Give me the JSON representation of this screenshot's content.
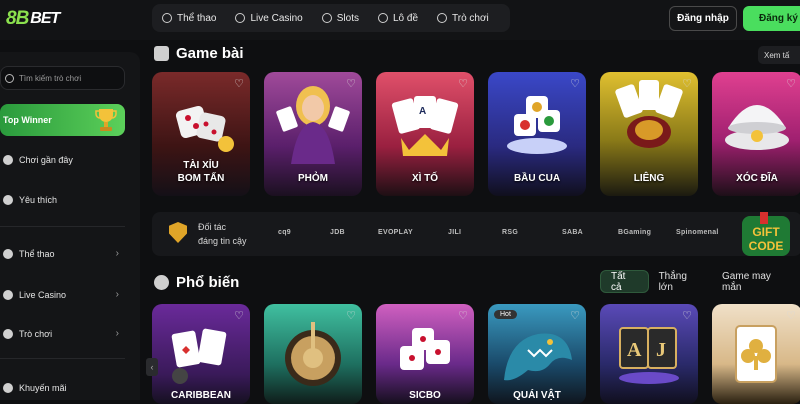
{
  "brand": {
    "logo_num": "8B",
    "logo_text": "BET"
  },
  "nav": [
    {
      "label": "Thể thao",
      "icon": "soccer-ball-icon"
    },
    {
      "label": "Live Casino",
      "icon": "chip-icon"
    },
    {
      "label": "Slots",
      "icon": "slots-icon"
    },
    {
      "label": "Lô đề",
      "icon": "lottery-icon"
    },
    {
      "label": "Trò chơi",
      "icon": "gamepad-icon"
    }
  ],
  "auth": {
    "login": "Đăng nhập",
    "register": "Đăng ký"
  },
  "sidebar": {
    "search_placeholder": "Tìm kiếm trò chơi",
    "top_winner": "Top Winner",
    "items": [
      {
        "label": "Chơi gần đây"
      },
      {
        "label": "Yêu thích"
      },
      {
        "label": "Thể thao",
        "chevron": "›"
      },
      {
        "label": "Live Casino",
        "chevron": "›"
      },
      {
        "label": "Trò chơi",
        "chevron": "›"
      },
      {
        "label": "Khuyến mãi"
      }
    ]
  },
  "section_card_games": {
    "title": "Game bài",
    "see_all": "Xem tấ",
    "cards": [
      {
        "title_1": "TÀI XỈU",
        "title_2": "BOM TẤN"
      },
      {
        "title_1": "PHỎM"
      },
      {
        "title_1": "XÌ TỐ"
      },
      {
        "title_1": "BẦU CUA"
      },
      {
        "title_1": "LIÊNG"
      },
      {
        "title_1": "XÓC ĐĨA"
      }
    ]
  },
  "partners": {
    "label_1": "Đối tác",
    "label_2": "đáng tin cậy",
    "logos": [
      "cq9",
      "JDB",
      "EVOPLAY",
      "JILI",
      "RSG",
      "SABA",
      "BGaming",
      "Spinomenal"
    ],
    "gift_1": "GIFT",
    "gift_2": "CODE"
  },
  "section_popular": {
    "title": "Phổ biến",
    "tabs": [
      "Tất cả",
      "Thắng lớn",
      "Game may mắn"
    ],
    "cards": [
      {
        "title": "CARIBBEAN"
      },
      {
        "title": ""
      },
      {
        "title": "SICBO"
      },
      {
        "title": "QUÁI VẬT",
        "badge": "Hot"
      },
      {
        "title": ""
      },
      {
        "title": ""
      }
    ]
  }
}
